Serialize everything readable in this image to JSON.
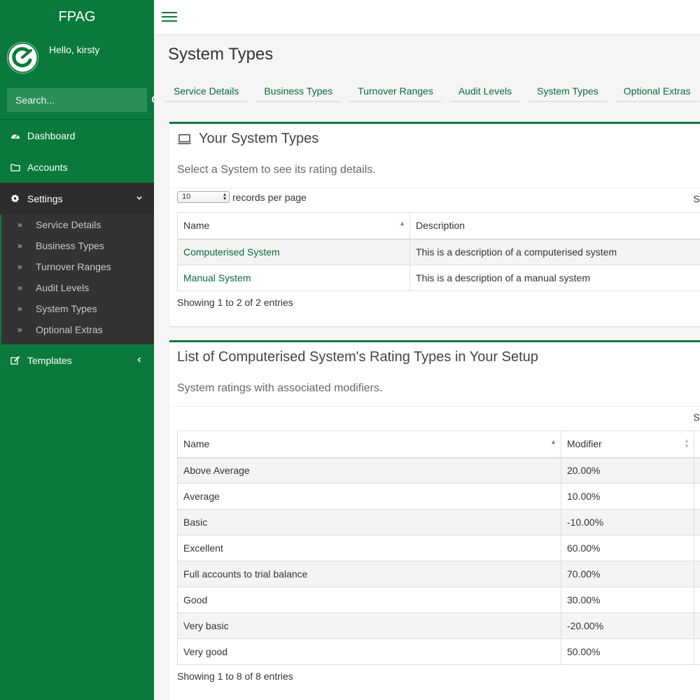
{
  "sidebar": {
    "brand": "FPAG",
    "greeting": "Hello, kirsty",
    "search_placeholder": "Search...",
    "menu": {
      "dashboard": "Dashboard",
      "accounts": "Accounts",
      "settings": "Settings",
      "templates": "Templates"
    },
    "settings_items": [
      "Service Details",
      "Business Types",
      "Turnover Ranges",
      "Audit Levels",
      "System Types",
      "Optional Extras"
    ]
  },
  "page": {
    "title": "System Types",
    "tabs": [
      "Service Details",
      "Business Types",
      "Turnover Ranges",
      "Audit Levels",
      "System Types",
      "Optional Extras"
    ]
  },
  "systems_box": {
    "title": "Your System Types",
    "subtitle": "Select a System to see its rating details.",
    "length_value": "10",
    "length_label": "records per page",
    "search_label": "Sear",
    "columns": [
      "Name",
      "Description"
    ],
    "rows": [
      {
        "name": "Computerised System",
        "description": "This is a description of a computerised system"
      },
      {
        "name": "Manual System",
        "description": "This is a description of a manual system"
      }
    ],
    "info": "Showing 1 to 2 of 2 entries"
  },
  "ratings_box": {
    "title": "List of Computerised System's Rating Types in Your Setup",
    "subtitle": "System ratings with associated modifiers.",
    "search_label": "Sear",
    "columns": [
      "Name",
      "Modifier"
    ],
    "rows": [
      {
        "name": "Above Average",
        "modifier": "20.00%"
      },
      {
        "name": "Average",
        "modifier": "10.00%"
      },
      {
        "name": "Basic",
        "modifier": "-10.00%"
      },
      {
        "name": "Excellent",
        "modifier": "60.00%"
      },
      {
        "name": "Full accounts to trial balance",
        "modifier": "70.00%"
      },
      {
        "name": "Good",
        "modifier": "30.00%"
      },
      {
        "name": "Very basic",
        "modifier": "-20.00%"
      },
      {
        "name": "Very good",
        "modifier": "50.00%"
      }
    ],
    "info": "Showing 1 to 8 of 8 entries"
  },
  "colors": {
    "brand_green": "#0a7a3c",
    "link_green": "#0a6b35",
    "sidebar_active": "#2d2d2d"
  }
}
